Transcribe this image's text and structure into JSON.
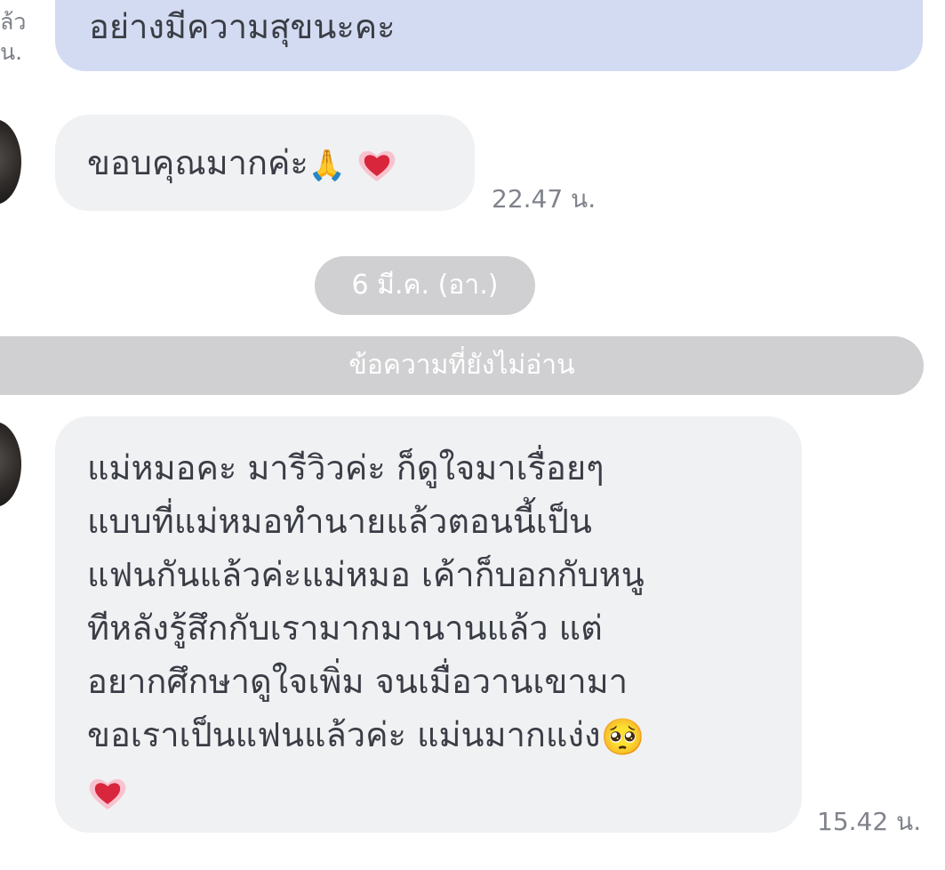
{
  "chat": {
    "prev_outgoing": {
      "text": "อย่างมีความสุขนะคะ",
      "receipt_line1": "ล้ว",
      "receipt_line2": "น."
    },
    "msg_thanks": {
      "text": "ขอบคุณมากค่ะ",
      "emoji_pray": "🙏",
      "emoji_heart": "💗",
      "time": "22.47 น."
    },
    "date_separator": "6 มี.ค. (อา.)",
    "unread_label": "ข้อความที่ยังไม่อ่าน",
    "msg_review": {
      "lines": [
        "แม่หมอคะ มารีวิวค่ะ ก็ดูใจมาเรื่อยๆ",
        "แบบที่แม่หมอทำนายแล้วตอนนี้เป็น",
        "แฟนกันแล้วค่ะแม่หมอ เค้าก็บอกกับหนู",
        "ทีหลังรู้สึกกับเรามากมานานแล้ว แต่",
        "อยากศึกษาดูใจเพิ่ม จนเมื่อวานเขามา",
        "ขอเราเป็นแฟนแล้วค่ะ แม่นมากแง่ง"
      ],
      "emoji_pleading": "🥺",
      "emoji_heart": "💗",
      "time": "15.42 น."
    }
  },
  "colors": {
    "outgoing_bubble": "#d2dbf1",
    "incoming_bubble": "#f0f1f3",
    "separator_pill": "#d0d0d2",
    "text": "#3a3d45",
    "timestamp": "#80838b"
  }
}
